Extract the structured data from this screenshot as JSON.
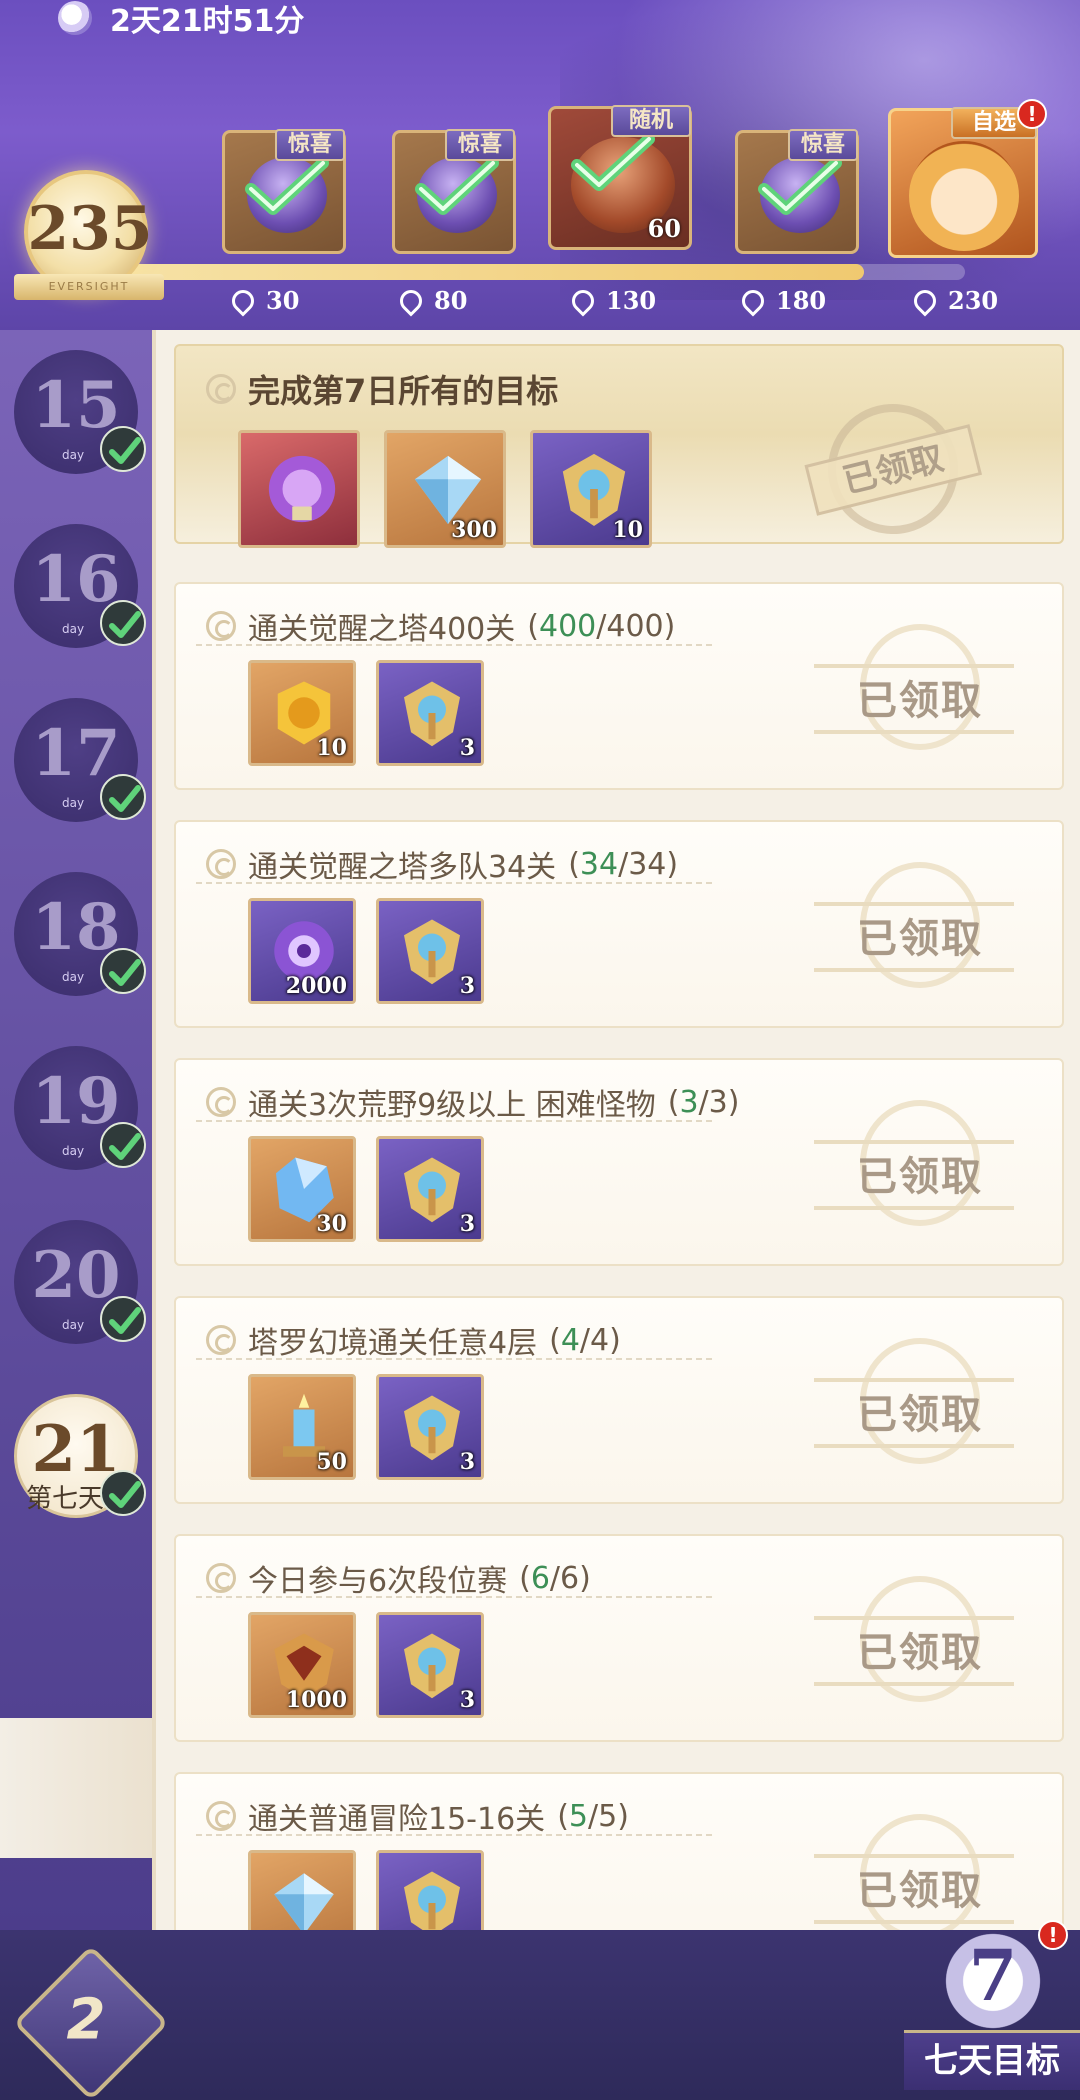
{
  "header": {
    "timer": "2天21时51分",
    "score": "235",
    "score_ribbon": "EVERSIGHT",
    "progress_fraction": 0.88,
    "milestones": [
      {
        "tag": "惊喜",
        "value": "30",
        "count": ""
      },
      {
        "tag": "惊喜",
        "value": "80",
        "count": ""
      },
      {
        "tag": "随机",
        "value": "130",
        "count": "60"
      },
      {
        "tag": "惊喜",
        "value": "180",
        "count": ""
      },
      {
        "tag": "自选",
        "value": "230",
        "count": ""
      }
    ],
    "alert_mark": "!"
  },
  "days": [
    {
      "num": "15",
      "label": "day"
    },
    {
      "num": "16",
      "label": "day"
    },
    {
      "num": "17",
      "label": "day"
    },
    {
      "num": "18",
      "label": "day"
    },
    {
      "num": "19",
      "label": "day"
    },
    {
      "num": "20",
      "label": "day"
    },
    {
      "num": "21",
      "label": "第七天"
    }
  ],
  "summary": {
    "title": "完成第7日所有的目标",
    "rewards": [
      {
        "qty": "",
        "icon": "purple-chest-icon"
      },
      {
        "qty": "300",
        "icon": "diamond-icon"
      },
      {
        "qty": "10",
        "icon": "gold-shield-icon"
      }
    ],
    "stamp": "已领取"
  },
  "tasks": [
    {
      "title": "通关觉醒之塔400关",
      "cur": "400",
      "total": "400",
      "rewards": [
        {
          "qty": "10",
          "icon": "gold-token-icon",
          "bg": "gold"
        },
        {
          "qty": "3",
          "icon": "shield-emblem-icon",
          "bg": "purple"
        }
      ],
      "status": "已领取"
    },
    {
      "title": "通关觉醒之塔多队34关",
      "cur": "34",
      "total": "34",
      "rewards": [
        {
          "qty": "2000",
          "icon": "purple-orb-icon",
          "bg": "purple"
        },
        {
          "qty": "3",
          "icon": "shield-emblem-icon",
          "bg": "purple"
        }
      ],
      "status": "已领取"
    },
    {
      "title": "通关3次荒野9级以上 困难怪物",
      "cur": "3",
      "total": "3",
      "rewards": [
        {
          "qty": "30",
          "icon": "blue-crystal-icon",
          "bg": "gold"
        },
        {
          "qty": "3",
          "icon": "shield-emblem-icon",
          "bg": "purple"
        }
      ],
      "status": "已领取"
    },
    {
      "title": "塔罗幻境通关任意4层",
      "cur": "4",
      "total": "4",
      "rewards": [
        {
          "qty": "50",
          "icon": "candle-icon",
          "bg": "gold"
        },
        {
          "qty": "3",
          "icon": "shield-emblem-icon",
          "bg": "purple"
        }
      ],
      "status": "已领取"
    },
    {
      "title": "今日参与6次段位赛",
      "cur": "6",
      "total": "6",
      "rewards": [
        {
          "qty": "1000",
          "icon": "crest-icon",
          "bg": "gold"
        },
        {
          "qty": "3",
          "icon": "shield-emblem-icon",
          "bg": "purple"
        }
      ],
      "status": "已领取"
    },
    {
      "title": "通关普通冒险15-16关",
      "cur": "5",
      "total": "5",
      "rewards": [
        {
          "qty": "",
          "icon": "diamond-icon",
          "bg": "gold"
        },
        {
          "qty": "",
          "icon": "shield-emblem-icon",
          "bg": "purple"
        }
      ],
      "status": "已领取"
    }
  ],
  "bottom": {
    "seven_number": "7",
    "seven_label": "七天目标",
    "back_glyph": "2"
  },
  "colors": {
    "progress_green": "#3d8f56",
    "header_purple": "#6b4fbf",
    "panel_bg": "#f5f0e6"
  }
}
